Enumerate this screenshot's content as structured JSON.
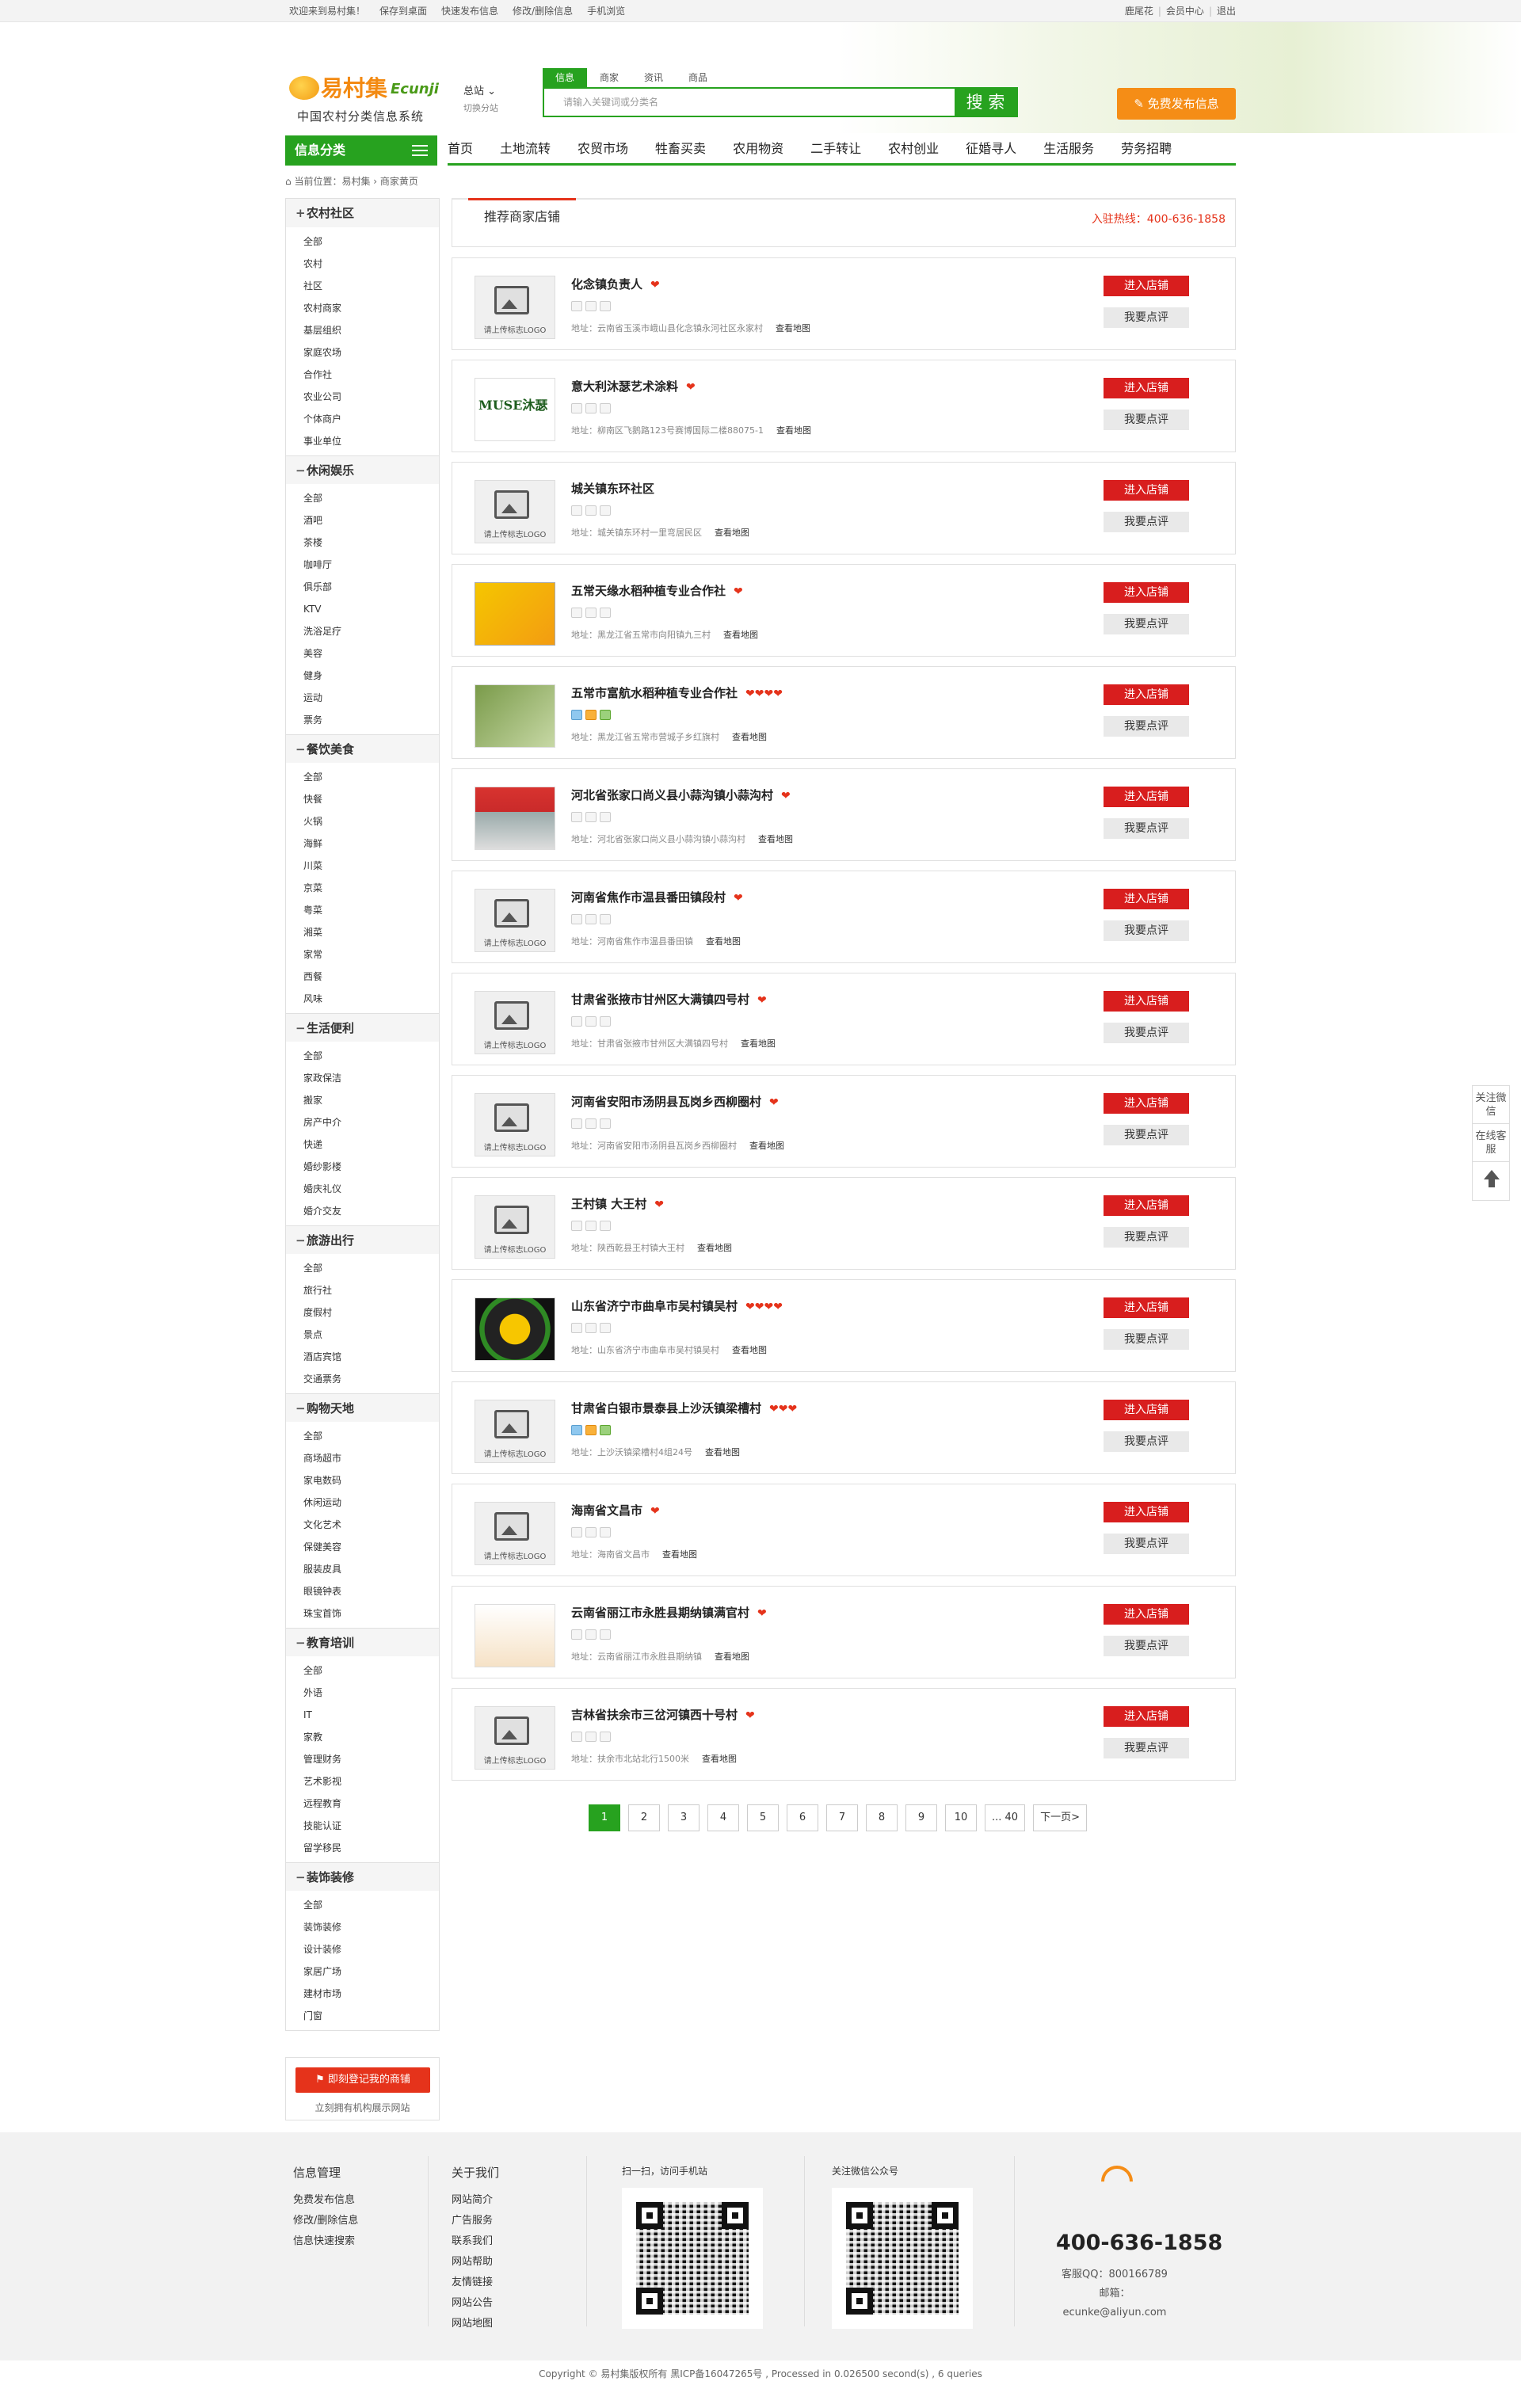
{
  "topbar": {
    "welcome": "欢迎来到易村集！",
    "save_desktop": "保存到桌面",
    "quick_post": "快速发布信息",
    "edit_delete": "修改/删除信息",
    "mobile": "手机浏览",
    "user": "鹿尾花",
    "member_center": "会员中心",
    "logout": "退出"
  },
  "header": {
    "logo_cn": "易村集",
    "logo_en": "Ecunji",
    "logo_sub": "中国农村分类信息系统",
    "station": "总站",
    "switch_station": "切换分站",
    "search_tabs": [
      "信息",
      "商家",
      "资讯",
      "商品"
    ],
    "search_placeholder": "请输入关键词或分类名",
    "search_button": "搜 索",
    "publish_button": "免费发布信息"
  },
  "nav": {
    "category_label": "信息分类",
    "links": [
      "首页",
      "土地流转",
      "农贸市场",
      "牲畜买卖",
      "农用物资",
      "二手转让",
      "农村创业",
      "征婚寻人",
      "生活服务",
      "劳务招聘"
    ]
  },
  "breadcrumb": {
    "text": "当前位置：易村集 › 商家黄页"
  },
  "sidebar": [
    {
      "title": "农村社区",
      "items": [
        "全部",
        "农村",
        "社区",
        "农村商家",
        "基层组织",
        "家庭农场",
        "合作社",
        "农业公司",
        "个体商户",
        "事业单位"
      ]
    },
    {
      "title": "休闲娱乐",
      "items": [
        "全部",
        "酒吧",
        "茶楼",
        "咖啡厅",
        "俱乐部",
        "KTV",
        "洗浴足疗",
        "美容",
        "健身",
        "运动",
        "票务"
      ]
    },
    {
      "title": "餐饮美食",
      "items": [
        "全部",
        "快餐",
        "火锅",
        "海鲜",
        "川菜",
        "京菜",
        "粤菜",
        "湘菜",
        "家常",
        "西餐",
        "风味"
      ]
    },
    {
      "title": "生活便利",
      "items": [
        "全部",
        "家政保洁",
        "搬家",
        "房产中介",
        "快递",
        "婚纱影楼",
        "婚庆礼仪",
        "婚介交友"
      ]
    },
    {
      "title": "旅游出行",
      "items": [
        "全部",
        "旅行社",
        "度假村",
        "景点",
        "酒店宾馆",
        "交通票务"
      ]
    },
    {
      "title": "购物天地",
      "items": [
        "全部",
        "商场超市",
        "家电数码",
        "休闲运动",
        "文化艺术",
        "保健美容",
        "服装皮具",
        "眼镜钟表",
        "珠宝首饰"
      ]
    },
    {
      "title": "教育培训",
      "items": [
        "全部",
        "外语",
        "IT",
        "家教",
        "管理财务",
        "艺术影视",
        "远程教育",
        "技能认证",
        "留学移民"
      ]
    },
    {
      "title": "装饰装修",
      "items": [
        "全部",
        "装饰装修",
        "设计装修",
        "家居广场",
        "建材市场",
        "门窗"
      ]
    }
  ],
  "register": {
    "button": "即刻登记我的商铺",
    "text": "立刻拥有机构展示网站"
  },
  "panel": {
    "tab": "推荐商家店铺",
    "hotline": "入驻热线：400-636-1858"
  },
  "shops": [
    {
      "name": "化念镇负责人",
      "hearts": "❤",
      "logo": "placeholder",
      "badges": [
        0,
        0,
        0
      ],
      "addr": "地址：云南省玉溪市峨山县化念镇永河社区永家村"
    },
    {
      "name": "意大利沐瑟艺术涂料",
      "hearts": "❤",
      "logo": "img1",
      "logo_text": "MUSE沐瑟",
      "badges": [
        0,
        0,
        0
      ],
      "addr": "地址：柳南区飞鹅路123号赛博国际二楼88075-1"
    },
    {
      "name": "城关镇东环社区",
      "hearts": "",
      "logo": "placeholder",
      "badges": [
        0,
        0,
        0
      ],
      "addr": "地址：城关镇东环村一里弯居民区"
    },
    {
      "name": "五常天缘水稻种植专业合作社",
      "hearts": "❤",
      "logo": "img2",
      "badges": [
        0,
        0,
        0
      ],
      "addr": "地址：黑龙江省五常市向阳镇九三村"
    },
    {
      "name": "五常市富航水稻种植专业合作社",
      "hearts": "❤❤❤❤",
      "logo": "img3",
      "badges": [
        1,
        2,
        3
      ],
      "addr": "地址：黑龙江省五常市营城子乡红旗村"
    },
    {
      "name": "河北省张家口尚义县小蒜沟镇小蒜沟村",
      "hearts": "❤",
      "logo": "img4",
      "badges": [
        0,
        0,
        0
      ],
      "addr": "地址：河北省张家口尚义县小蒜沟镇小蒜沟村"
    },
    {
      "name": "河南省焦作市温县番田镇段村",
      "hearts": "❤",
      "logo": "placeholder",
      "badges": [
        0,
        0,
        0
      ],
      "addr": "地址：河南省焦作市温县番田镇"
    },
    {
      "name": "甘肃省张掖市甘州区大满镇四号村",
      "hearts": "❤",
      "logo": "placeholder",
      "badges": [
        0,
        0,
        0
      ],
      "addr": "地址：甘肃省张掖市甘州区大满镇四号村"
    },
    {
      "name": "河南省安阳市汤阴县瓦岗乡西柳圈村",
      "hearts": "❤",
      "logo": "placeholder",
      "badges": [
        0,
        0,
        0
      ],
      "addr": "地址：河南省安阳市汤阴县瓦岗乡西柳圈村"
    },
    {
      "name": "王村镇 大王村",
      "hearts": "❤",
      "logo": "placeholder",
      "badges": [
        0,
        0,
        0
      ],
      "addr": "地址：陕西乾县王村镇大王村"
    },
    {
      "name": "山东省济宁市曲阜市吴村镇吴村",
      "hearts": "❤❤❤❤",
      "logo": "img5",
      "badges": [
        0,
        0,
        0
      ],
      "addr": "地址：山东省济宁市曲阜市吴村镇吴村"
    },
    {
      "name": "甘肃省白银市景泰县上沙沃镇梁槽村",
      "hearts": "❤❤❤",
      "logo": "placeholder",
      "badges": [
        1,
        2,
        3
      ],
      "addr": "地址：上沙沃镇梁槽村4组24号"
    },
    {
      "name": "海南省文昌市",
      "hearts": "❤",
      "logo": "placeholder",
      "badges": [
        0,
        0,
        0
      ],
      "addr": "地址：海南省文昌市"
    },
    {
      "name": "云南省丽江市永胜县期纳镇满官村",
      "hearts": "❤",
      "logo": "img6",
      "badges": [
        0,
        0,
        0
      ],
      "addr": "地址：云南省丽江市永胜县期纳镇"
    },
    {
      "name": "吉林省扶余市三岔河镇西十号村",
      "hearts": "❤",
      "logo": "placeholder",
      "badges": [
        0,
        0,
        0
      ],
      "addr": "地址：扶余市北站北行1500米"
    }
  ],
  "card_labels": {
    "view_map": "查看地图",
    "enter": "进入店铺",
    "review": "我要点评",
    "logo_placeholder": "请上传标志LOGO"
  },
  "pager": [
    "1",
    "2",
    "3",
    "4",
    "5",
    "6",
    "7",
    "8",
    "9",
    "10",
    "... 40",
    "下一页>"
  ],
  "float": [
    "关注微信",
    "在线客服"
  ],
  "footer": {
    "col1": {
      "title": "信息管理",
      "items": [
        "免费发布信息",
        "修改/删除信息",
        "信息快速搜索"
      ]
    },
    "col2": {
      "title": "关于我们",
      "items": [
        "网站简介",
        "广告服务",
        "联系我们",
        "网站帮助",
        "友情链接",
        "网站公告",
        "网站地图"
      ]
    },
    "qr1": "扫一扫，访问手机站",
    "qr2": "关注微信公众号",
    "phone": "400-636-1858",
    "qq": "客服QQ：800166789",
    "email": "邮箱：ecunke@aliyun.com"
  },
  "copyright": "Copyright © 易村集版权所有 黑ICP备16047265号 , Processed in 0.026500 second(s) , 6 queries",
  "colors": {
    "green": "#27a21f",
    "orange": "#f58d16",
    "red": "#d81e1e"
  }
}
